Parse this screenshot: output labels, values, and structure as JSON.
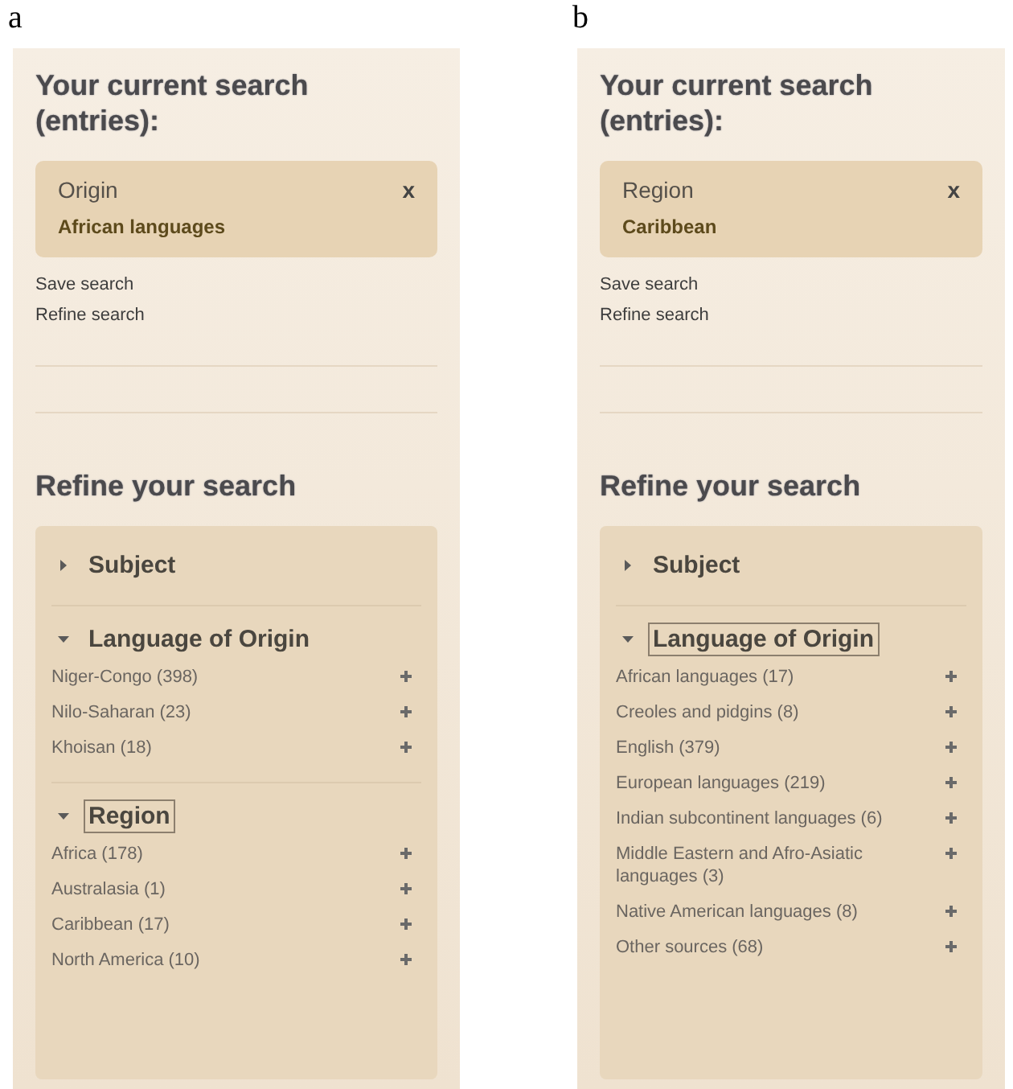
{
  "panels": [
    {
      "label": "a",
      "current_heading": "Your current search (entries):",
      "filter": {
        "field": "Origin",
        "value": "African languages",
        "remove": "x"
      },
      "links": [
        "Save search",
        "Refine search"
      ],
      "refine_heading": "Refine your search",
      "facets": [
        {
          "title": "Subject",
          "expanded": false,
          "focused": false
        },
        {
          "title": "Language of Origin",
          "expanded": true,
          "focused": false,
          "items": [
            "Niger-Congo (398)",
            "Nilo-Saharan (23)",
            "Khoisan (18)"
          ]
        },
        {
          "title": "Region",
          "expanded": true,
          "focused": true,
          "items": [
            "Africa (178)",
            "Australasia (1)",
            "Caribbean (17)",
            "North America (10)"
          ]
        }
      ]
    },
    {
      "label": "b",
      "current_heading": "Your current search (entries):",
      "filter": {
        "field": "Region",
        "value": "Caribbean",
        "remove": "x"
      },
      "links": [
        "Save search",
        "Refine search"
      ],
      "refine_heading": "Refine your search",
      "facets": [
        {
          "title": "Subject",
          "expanded": false,
          "focused": false
        },
        {
          "title": "Language of Origin",
          "expanded": true,
          "focused": true,
          "items": [
            "African languages (17)",
            "Creoles and pidgins (8)",
            "English (379)",
            "European languages (219)",
            "Indian subcontinent languages (6)",
            "Middle Eastern and Afro-Asiatic languages (3)",
            "Native American languages (8)",
            "Other sources (68)"
          ]
        }
      ]
    }
  ]
}
